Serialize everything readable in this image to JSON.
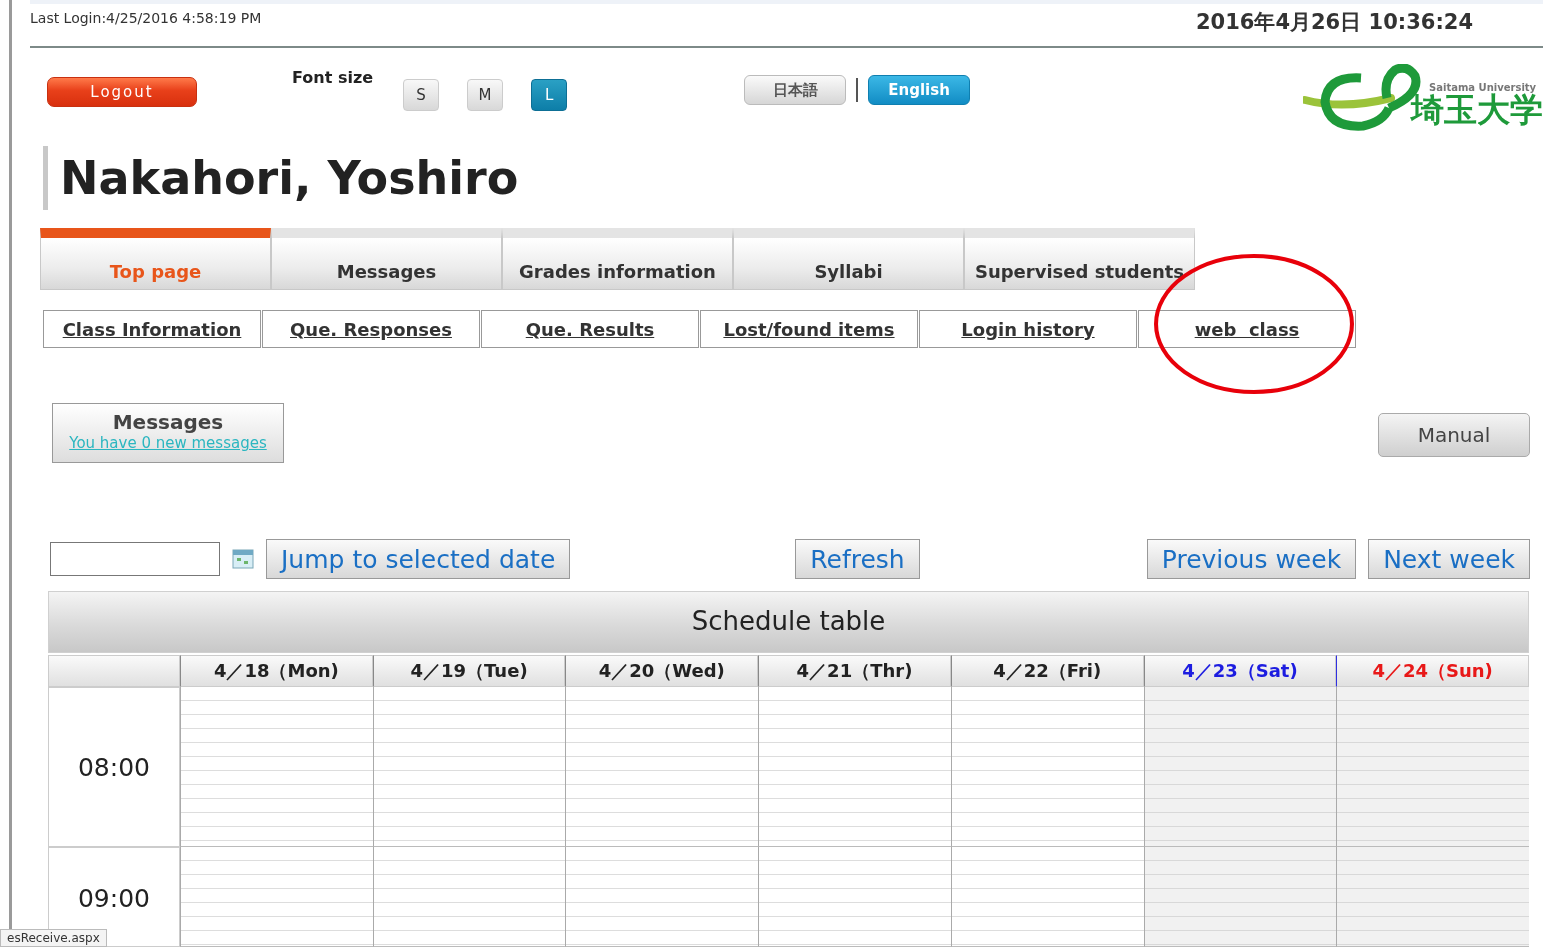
{
  "last_login": "Last Login:4/25/2016 4:58:19 PM",
  "clock": "2016年4月26日 10:36:24",
  "logout_button": "Logout",
  "font_size": {
    "label": "Font size",
    "options": [
      {
        "label": "S",
        "selected": false
      },
      {
        "label": "M",
        "selected": false
      },
      {
        "label": "L",
        "selected": true
      }
    ]
  },
  "languages": [
    {
      "label": "日本語",
      "selected": false
    },
    {
      "label": "English",
      "selected": true
    }
  ],
  "logo": {
    "subtitle": "Saitama University",
    "name": "埼玉大学"
  },
  "user_name": "Nakahori, Yoshiro",
  "tabs": [
    {
      "label": "Top page",
      "selected": true
    },
    {
      "label": "Messages",
      "selected": false
    },
    {
      "label": "Grades information",
      "selected": false
    },
    {
      "label": "Syllabi",
      "selected": false
    },
    {
      "label": "Supervised students",
      "selected": false
    }
  ],
  "sub_links": [
    {
      "label": "Class Information",
      "circled": false
    },
    {
      "label": "Que. Responses",
      "circled": false
    },
    {
      "label": "Que. Results",
      "circled": false
    },
    {
      "label": "Lost/found items",
      "circled": false
    },
    {
      "label": "Login history",
      "circled": false
    },
    {
      "label": "web  class",
      "circled": true
    }
  ],
  "messages_box": {
    "title": "Messages",
    "link": "You have  0 new messages"
  },
  "manual_button": "Manual",
  "buttons": {
    "jump": "Jump to selected date",
    "refresh": "Refresh",
    "previous": "Previous week",
    "next": "Next week"
  },
  "schedule": {
    "title": "Schedule table",
    "days": [
      {
        "label": "4／18（Mon)",
        "kind": "weekday"
      },
      {
        "label": "4／19（Tue)",
        "kind": "weekday"
      },
      {
        "label": "4／20（Wed)",
        "kind": "weekday"
      },
      {
        "label": "4／21（Thr)",
        "kind": "weekday"
      },
      {
        "label": "4／22（Fri)",
        "kind": "weekday"
      },
      {
        "label": "4／23（Sat)",
        "kind": "saturday"
      },
      {
        "label": "4／24（Sun)",
        "kind": "sunday"
      }
    ],
    "times": [
      "08:00",
      "09:00"
    ]
  },
  "status_text": "esReceive.aspx"
}
